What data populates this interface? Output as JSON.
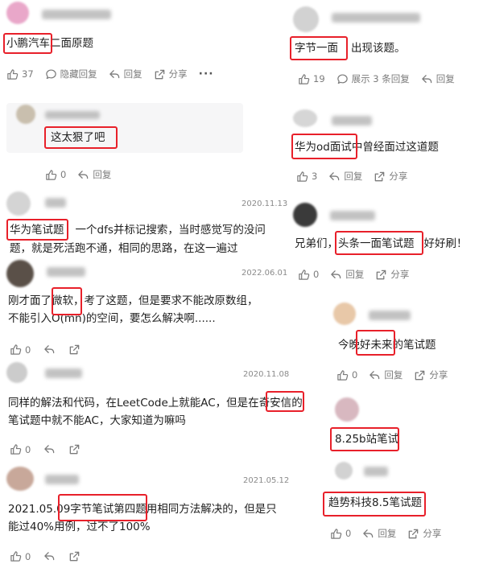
{
  "colors": {
    "highlight": "#e8202a",
    "action_text": "#7b7b7b",
    "reply_bg": "#f6f6f7"
  },
  "actions": {
    "hide_replies": "隐藏回复",
    "reply": "回复",
    "share": "分享",
    "show_3_replies": "展示 3 条回复",
    "more": "···"
  },
  "left": {
    "c1": {
      "text_hl": "小鹏汽车",
      "text_rest": "二面原题",
      "likes": "37"
    },
    "c1r": {
      "text_hl": "这太狠了吧",
      "likes": "0"
    },
    "c2": {
      "date": "2020.11.13",
      "hl": "华为笔试题",
      "line1_rest": "一个dfs并标记搜索，当时感觉写的没问",
      "line2": "题，就是死活跑不通，相同的思路，在这一遍过"
    },
    "c3": {
      "date": "2022.06.01",
      "line1_pre": "刚才面了",
      "hl": "微软",
      "line1_rest": "，考了这题，但是要求不能改原数组，",
      "line2": "不能引入O(mn)的空间，要怎么解决啊......",
      "likes": "0"
    },
    "c4": {
      "date": "2020.11.08",
      "line1_pre": "同样的解法和代码，在LeetCode上就能AC，但是在",
      "hl": "奇安信",
      "line1_rest": "的",
      "line2": "笔试题中就不能AC，大家知道为嘛吗",
      "likes": "0"
    },
    "c5": {
      "date": "2021.05.12",
      "line1_pre": "2021.05.0",
      "hl": "9字节笔试第四题",
      "line1_rest": "用相同方法解决的，但是只",
      "line2": "能过40%用例，过不了100%",
      "likes": "0"
    }
  },
  "right": {
    "c1": {
      "hl": "字节一面",
      "text_rest": "出现该题。",
      "likes": "19"
    },
    "c2": {
      "hl": "华为od面试",
      "text_rest": "中曾经面过这道题",
      "likes": "3"
    },
    "c3": {
      "pre": "兄弟们，",
      "hl": "头条一面笔试题",
      "rest": "好好刷！",
      "likes": "0"
    },
    "c4": {
      "pre": "今晚",
      "hl": "好未来",
      "rest": "的笔试题",
      "likes": "0"
    },
    "c5": {
      "hl": "8.25b站笔试"
    },
    "c6": {
      "hl": "趋势科技8.5笔试题",
      "likes": "0"
    }
  }
}
